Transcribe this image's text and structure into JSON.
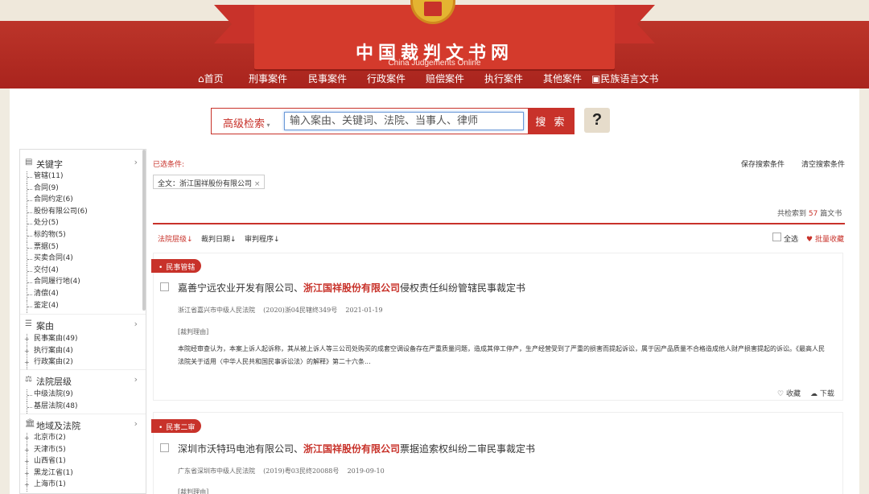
{
  "site": {
    "title": "中国裁判文书网",
    "subtitle": "China Judgements Online"
  },
  "nav": [
    "首页",
    "刑事案件",
    "民事案件",
    "行政案件",
    "赔偿案件",
    "执行案件",
    "其他案件",
    "民族语言文书"
  ],
  "search": {
    "advanced_label": "高级检索",
    "placeholder": "输入案由、关键词、法院、当事人、律师",
    "button": "搜 索",
    "help": "?"
  },
  "sidebar": {
    "keywords": {
      "title": "关键字",
      "items": [
        "管辖(11)",
        "合同(9)",
        "合同约定(6)",
        "股份有限公司(6)",
        "处分(5)",
        "标的物(5)",
        "票据(5)",
        "买卖合同(4)",
        "交付(4)",
        "合同履行地(4)",
        "清偿(4)",
        "鉴定(4)"
      ]
    },
    "cause": {
      "title": "案由",
      "items": [
        "民事案由(49)",
        "执行案由(4)",
        "行政案由(2)"
      ]
    },
    "court_level": {
      "title": "法院层级",
      "items": [
        "中级法院(9)",
        "基层法院(48)"
      ]
    },
    "region": {
      "title": "地域及法院",
      "items": [
        "北京市(2)",
        "天津市(5)",
        "山西省(1)",
        "黑龙江省(1)",
        "上海市(1)"
      ]
    }
  },
  "filters": {
    "selected_label": "已选条件:",
    "save": "保存搜索条件",
    "clear": "清空搜索条件",
    "chip": "全文：浙江国祥股份有限公司",
    "chip_close": "×",
    "count_prefix": "共检索到",
    "count": "57",
    "count_suffix": "篇文书",
    "sorts": [
      "法院层级↓",
      "裁判日期↓",
      "审判程序↓"
    ],
    "select_all": "全选",
    "bulk_fav": "批量收藏"
  },
  "results": [
    {
      "tag": "民事管辖",
      "title_pre": "嘉善宁远农业开发有限公司、",
      "title_hl": "浙江国祥股份有限公司",
      "title_post": "侵权责任纠纷管辖民事裁定书",
      "court": "浙江省嘉兴市中级人民法院",
      "case_no": "(2020)浙04民辖终349号",
      "date": "2021-01-19",
      "reason_label": "[裁判理由]",
      "reason": "本院经审查认为，本案上诉人起诉称，其从被上诉人等三公司处购买的成套空调设备存在严重质量问题，造成其停工停产，生产经营受到了严重的损害而提起诉讼，属于因产品质量不合格造成他人财产损害提起的诉讼。《最高人民法院关于适用〈中华人民共和国民事诉讼法〉的解释》第二十六条...",
      "fav": "收藏",
      "download": "下载"
    },
    {
      "tag": "民事二审",
      "title_pre": "深圳市沃特玛电池有限公司、",
      "title_hl": "浙江国祥股份有限公司",
      "title_post": "票据追索权纠纷二审民事裁定书",
      "court": "广东省深圳市中级人民法院",
      "case_no": "(2019)粤03民终20088号",
      "date": "2019-09-10",
      "reason_label": "[裁判理由]"
    }
  ]
}
